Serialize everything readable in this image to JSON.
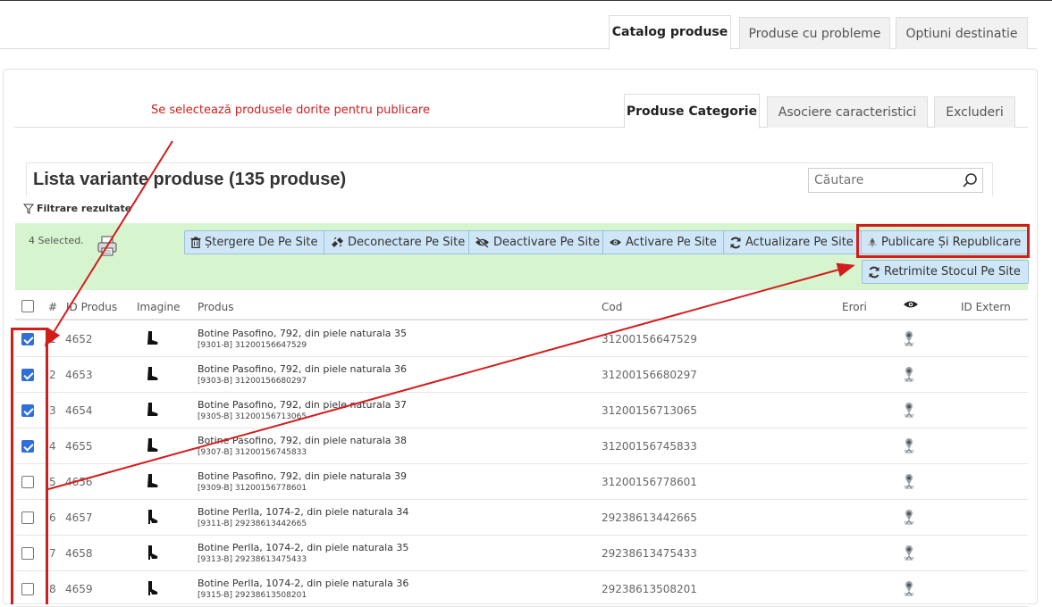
{
  "top_tabs": [
    {
      "label": "Catalog produse",
      "active": true
    },
    {
      "label": "Produse cu probleme",
      "active": false
    },
    {
      "label": "Optiuni destinatie",
      "active": false
    }
  ],
  "annotation": "Se selectează produsele dorite pentru publicare",
  "sub_tabs": [
    {
      "label": "Produse Categorie",
      "active": true
    },
    {
      "label": "Asociere caracteristici",
      "active": false
    },
    {
      "label": "Excluderi",
      "active": false
    }
  ],
  "list": {
    "title": "Lista variante produse (135 produse)",
    "search_placeholder": "Căutare",
    "filter_label": "Filtrare rezultate"
  },
  "actions": {
    "selected_label": "4 Selected.",
    "buttons": [
      {
        "label": "Ștergere De Pe Site",
        "icon": "trash-icon"
      },
      {
        "label": "Deconectare Pe Site",
        "icon": "unlink-icon"
      },
      {
        "label": "Deactivare Pe Site",
        "icon": "eye-slash-icon"
      },
      {
        "label": "Activare Pe Site",
        "icon": "eye-icon"
      },
      {
        "label": "Actualizare Pe Site",
        "icon": "refresh-icon"
      },
      {
        "label": "Publicare Și Republicare",
        "icon": "publish-icon"
      },
      {
        "label": "Retrimite Stocul Pe Site",
        "icon": "refresh-icon"
      }
    ]
  },
  "table": {
    "columns": [
      "#",
      "ID Produs",
      "Imagine",
      "Produs",
      "Cod",
      "Erori",
      "eye-icon",
      "ID Extern"
    ],
    "rows": [
      {
        "num": "1",
        "id": "4652",
        "name": "Botine Pasofino, 792, din piele naturala 35",
        "sku": "[9301-B] 31200156647529",
        "cod": "31200156647529",
        "checked": true
      },
      {
        "num": "2",
        "id": "4653",
        "name": "Botine Pasofino, 792, din piele naturala 36",
        "sku": "[9303-B] 31200156680297",
        "cod": "31200156680297",
        "checked": true
      },
      {
        "num": "3",
        "id": "4654",
        "name": "Botine Pasofino, 792, din piele naturala 37",
        "sku": "[9305-B] 31200156713065",
        "cod": "31200156713065",
        "checked": true
      },
      {
        "num": "4",
        "id": "4655",
        "name": "Botine Pasofino, 792, din piele naturala 38",
        "sku": "[9307-B] 31200156745833",
        "cod": "31200156745833",
        "checked": true
      },
      {
        "num": "5",
        "id": "4656",
        "name": "Botine Pasofino, 792, din piele naturala 39",
        "sku": "[9309-B] 31200156778601",
        "cod": "31200156778601",
        "checked": false
      },
      {
        "num": "6",
        "id": "4657",
        "name": "Botine Perlla, 1074-2, din piele naturala 34",
        "sku": "[9311-B] 29238613442665",
        "cod": "29238613442665",
        "checked": false
      },
      {
        "num": "7",
        "id": "4658",
        "name": "Botine Perlla, 1074-2, din piele naturala 35",
        "sku": "[9313-B] 29238613475433",
        "cod": "29238613475433",
        "checked": false
      },
      {
        "num": "8",
        "id": "4659",
        "name": "Botine Perlla, 1074-2, din piele naturala 36",
        "sku": "[9315-B] 29238613508201",
        "cod": "29238613508201",
        "checked": false
      }
    ]
  },
  "colors": {
    "accent_red": "#d21d1d",
    "action_bar": "#d6f5cf",
    "button_bg": "#cfe6f7",
    "checkbox_checked": "#2f6fd6"
  }
}
